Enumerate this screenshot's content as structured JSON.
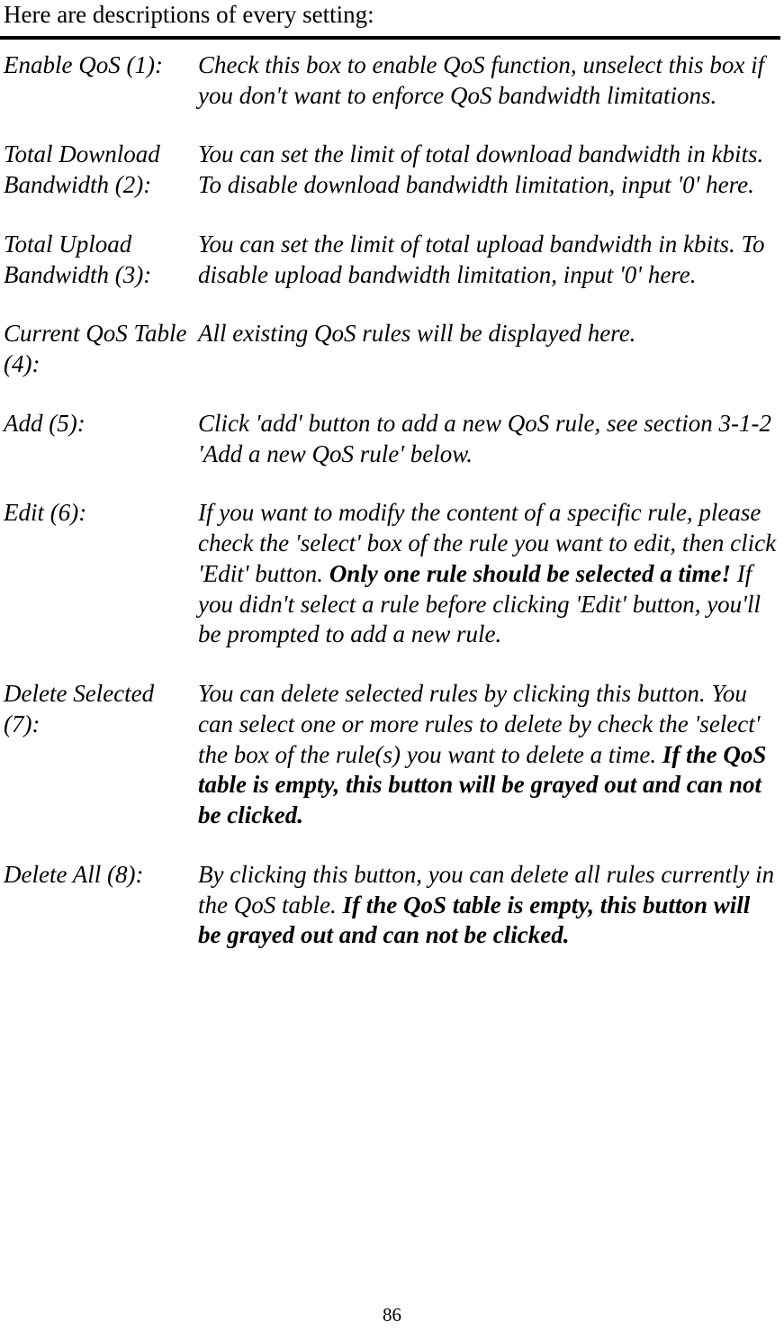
{
  "intro": "Here are descriptions of every setting:",
  "items": [
    {
      "term": "Enable QoS (1):",
      "desc_pre": "Check this box to enable QoS function, unselect this box if you don't want to enforce QoS bandwidth limitations.",
      "desc_bold": "",
      "desc_post": ""
    },
    {
      "term": "Total Download Bandwidth (2):",
      "desc_pre": "You can set the limit of total download bandwidth in kbits. To disable download bandwidth limitation, input '0' here.",
      "desc_bold": "",
      "desc_post": ""
    },
    {
      "term": "Total Upload Bandwidth (3):",
      "desc_pre": "You can set the limit of total upload bandwidth in kbits. To disable upload bandwidth limitation, input '0' here.",
      "desc_bold": "",
      "desc_post": ""
    },
    {
      "term": "Current QoS Table (4):",
      "desc_pre": "All existing QoS rules will be displayed here.",
      "desc_bold": "",
      "desc_post": ""
    },
    {
      "term": "Add (5):",
      "desc_pre": "Click 'add' button to add a new QoS rule, see section 3-1-2 'Add a new QoS rule' below.",
      "desc_bold": "",
      "desc_post": ""
    },
    {
      "term": "Edit (6):",
      "desc_pre": "If you want to modify the content of a specific rule, please check the 'select' box of the rule you want to edit, then click 'Edit' button. ",
      "desc_bold": "Only one rule should be selected a time!",
      "desc_post": " If you didn't select a rule before clicking 'Edit' button, you'll be prompted to add a new rule."
    },
    {
      "term": "Delete Selected (7):",
      "desc_pre": "You can delete selected rules by clicking this button. You can select one or more rules to delete by check the 'select' the box of the rule(s) you want to delete a time. ",
      "desc_bold": "If the QoS table is empty, this button will be grayed out and can not be clicked.",
      "desc_post": ""
    },
    {
      "term": "Delete All (8):",
      "desc_pre": "By clicking this button, you can delete all rules currently in the QoS table. ",
      "desc_bold": "If the QoS table is empty, this button will be grayed out and can not be clicked.",
      "desc_post": ""
    }
  ],
  "page_number": "86"
}
